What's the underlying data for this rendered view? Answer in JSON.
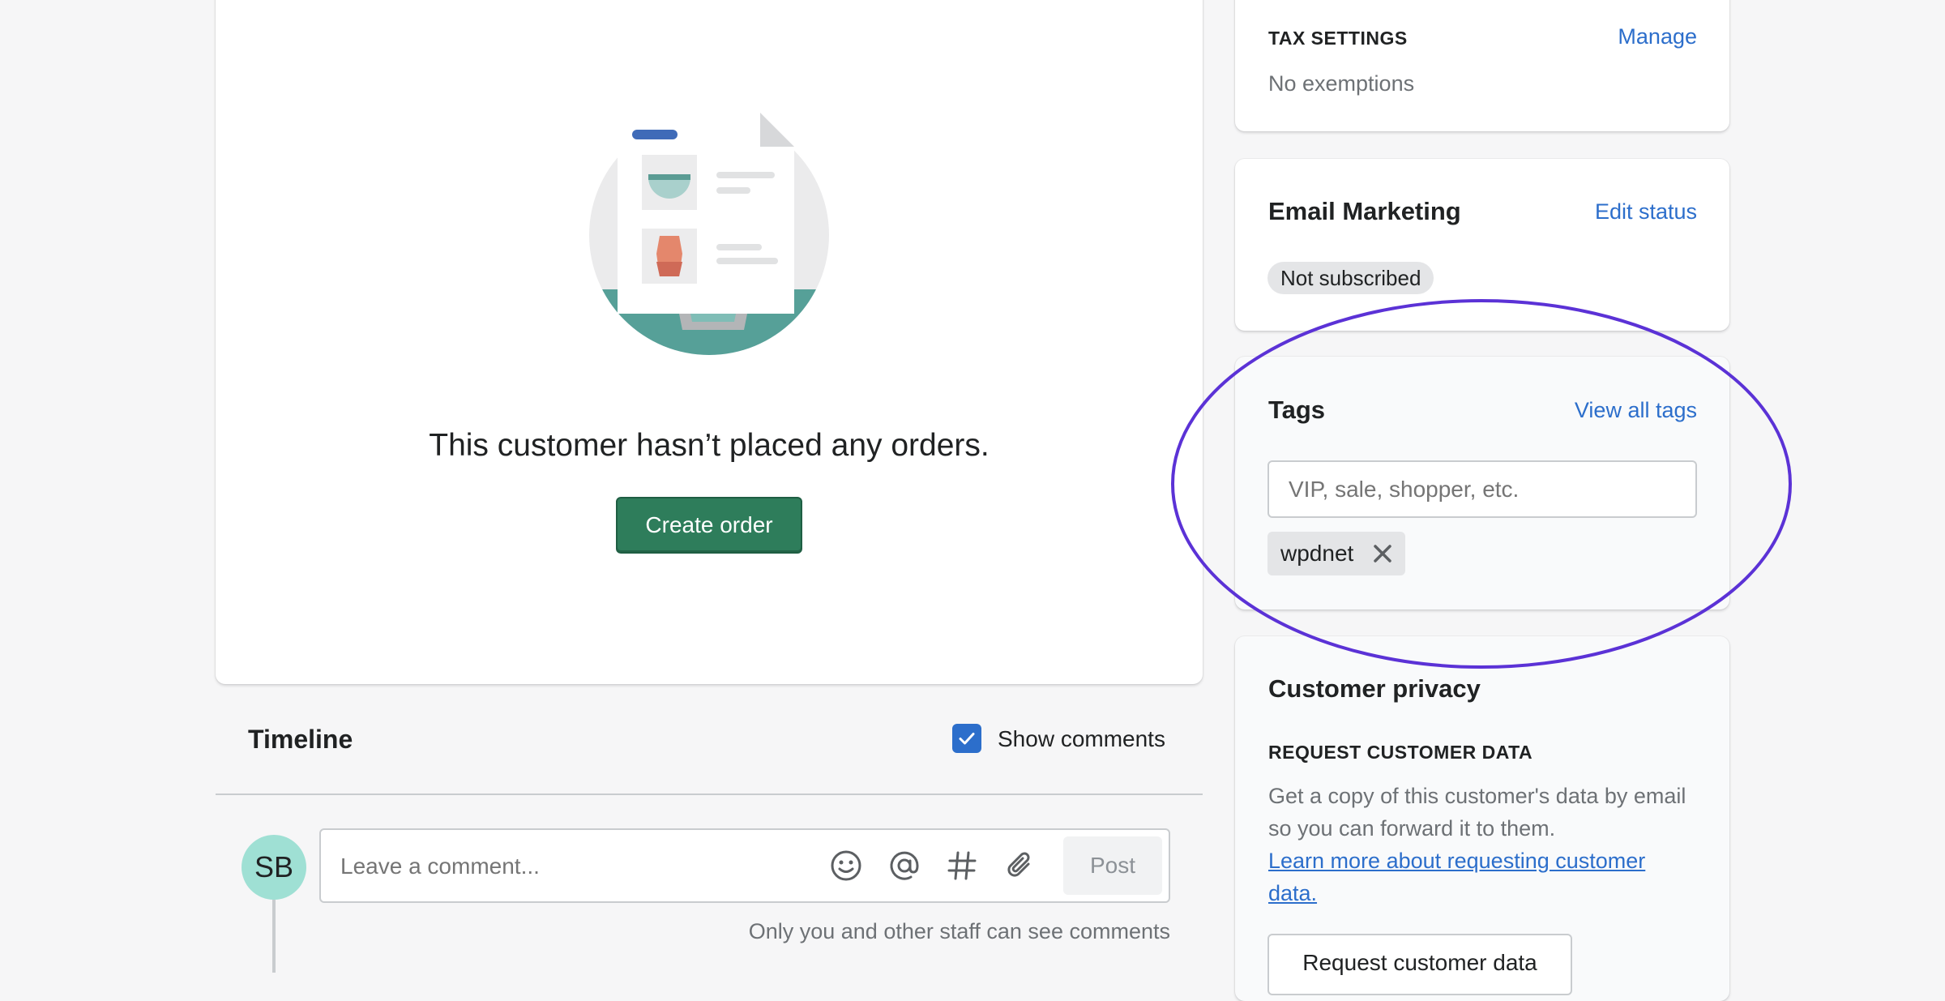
{
  "empty_orders": {
    "message": "This customer hasn’t placed any orders.",
    "create_button": "Create order"
  },
  "timeline": {
    "title": "Timeline",
    "show_comments_label": "Show comments",
    "show_comments_checked": true,
    "avatar_initials": "SB",
    "comment_placeholder": "Leave a comment...",
    "post_button": "Post",
    "staff_note": "Only you and other staff can see comments",
    "composer_icons": [
      "smiley-icon",
      "at-icon",
      "hashtag-icon",
      "paperclip-icon"
    ]
  },
  "tax_settings": {
    "title": "TAX SETTINGS",
    "manage_link": "Manage",
    "value": "No exemptions"
  },
  "email_marketing": {
    "title": "Email Marketing",
    "edit_link": "Edit status",
    "status_badge": "Not subscribed"
  },
  "tags": {
    "title": "Tags",
    "view_all_link": "View all tags",
    "input_placeholder": "VIP, sale, shopper, etc.",
    "items": [
      {
        "label": "wpdnet"
      }
    ]
  },
  "customer_privacy": {
    "title": "Customer privacy",
    "subtitle": "REQUEST CUSTOMER DATA",
    "description": "Get a copy of this customer's data by email so you can forward it to them.",
    "learn_more_link": "Learn more about requesting customer data.",
    "request_button": "Request customer data"
  },
  "colors": {
    "primary_button": "#2e7d5b",
    "link": "#2c6ecb",
    "annotation_ellipse": "#5b32d6",
    "avatar": "#9fe0d4",
    "checkbox": "#2c6ecb"
  }
}
